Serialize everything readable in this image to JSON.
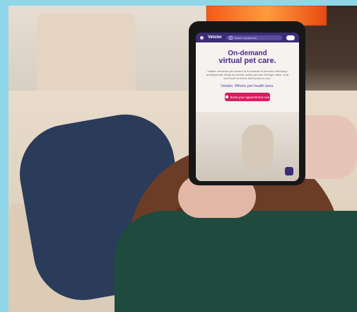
{
  "tablet": {
    "brand": "Vetster",
    "search_placeholder": "Search symptoms",
    "headline_line1": "On-demand",
    "headline_line2": "virtual pet care.",
    "description": "Vetster connects pet owners to thousands of licensed veterinary professionals ready to provide online pet care through video, chat and more at a time that works for you.",
    "tagline": "Vetster. Where pet health lives.",
    "cta_label": "Book your appointment now"
  },
  "colors": {
    "nav_bg": "#3b2d78",
    "headline_purple": "#4b2a8e",
    "cta_pink": "#d21f5d"
  },
  "icons": {
    "brand": "heart-icon",
    "search": "search-icon",
    "toggle": "toggle-icon",
    "cta": "calendar-icon",
    "chat": "chat-icon"
  }
}
